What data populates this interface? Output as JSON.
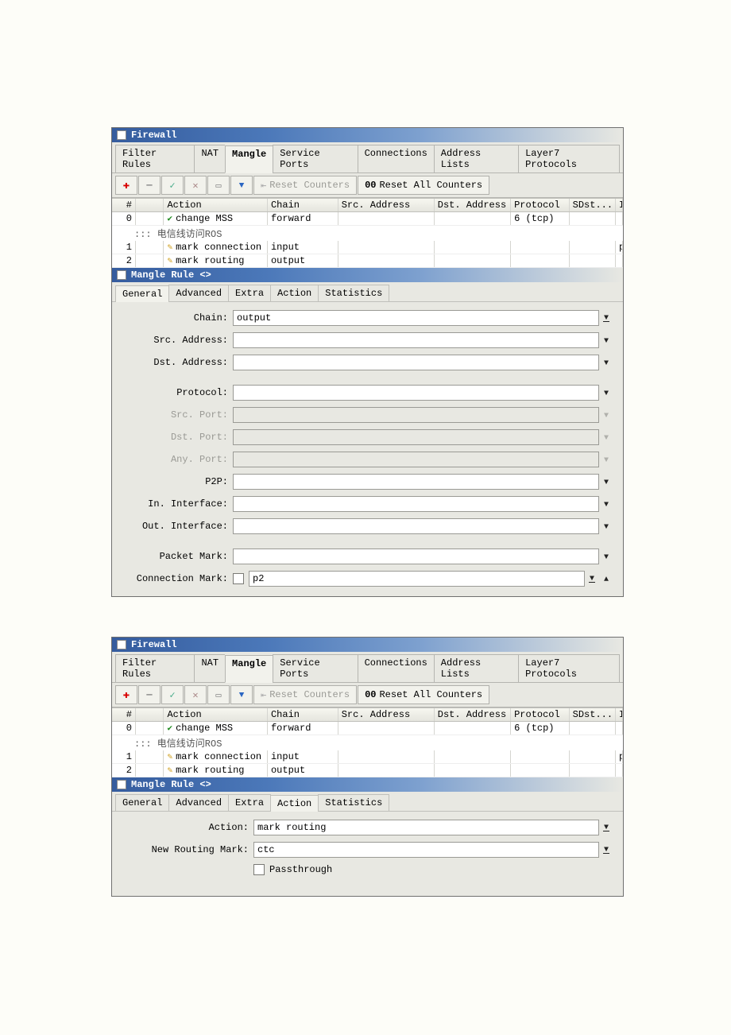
{
  "window1": {
    "title": "Firewall",
    "tabs": [
      "Filter Rules",
      "NAT",
      "Mangle",
      "Service Ports",
      "Connections",
      "Address Lists",
      "Layer7 Protocols"
    ],
    "active_tab": 2,
    "toolbar": {
      "reset_counters": "Reset Counters",
      "reset_all": "Reset All Counters",
      "reset_all_prefix": "00"
    },
    "columns": [
      "#",
      "",
      "Action",
      "Chain",
      "Src. Address",
      "Dst. Address",
      "Protocol",
      "SDst...",
      "In. In"
    ],
    "rows": [
      {
        "idx": "0",
        "action": "change MSS",
        "icon": "check",
        "chain": "forward",
        "src": "",
        "dst": "",
        "proto": "6 (tcp)",
        "sdst": "",
        "in": ""
      }
    ],
    "comment_row": "::: 电信线访问ROS",
    "rows2": [
      {
        "idx": "1",
        "action": "mark connection",
        "icon": "pen",
        "chain": "input",
        "src": "",
        "dst": "",
        "proto": "",
        "sdst": "",
        "in": "pppoe-"
      },
      {
        "idx": "2",
        "action": "mark routing",
        "icon": "pen",
        "chain": "output",
        "src": "",
        "dst": "",
        "proto": "",
        "sdst": "",
        "in": ""
      }
    ]
  },
  "dialog1": {
    "title": "Mangle Rule <>",
    "tabs": [
      "General",
      "Advanced",
      "Extra",
      "Action",
      "Statistics"
    ],
    "active_tab": 0,
    "fields": {
      "chain": {
        "label": "Chain:",
        "value": "output"
      },
      "src_addr": {
        "label": "Src. Address:",
        "value": ""
      },
      "dst_addr": {
        "label": "Dst. Address:",
        "value": ""
      },
      "protocol": {
        "label": "Protocol:",
        "value": ""
      },
      "src_port": {
        "label": "Src. Port:",
        "value": "",
        "disabled": true
      },
      "dst_port": {
        "label": "Dst. Port:",
        "value": "",
        "disabled": true
      },
      "any_port": {
        "label": "Any. Port:",
        "value": "",
        "disabled": true
      },
      "p2p": {
        "label": "P2P:",
        "value": ""
      },
      "in_if": {
        "label": "In. Interface:",
        "value": ""
      },
      "out_if": {
        "label": "Out. Interface:",
        "value": ""
      },
      "packet_mark": {
        "label": "Packet Mark:",
        "value": ""
      },
      "conn_mark": {
        "label": "Connection Mark:",
        "value": "p2"
      }
    }
  },
  "dialog2": {
    "title": "Mangle Rule <>",
    "tabs": [
      "General",
      "Advanced",
      "Extra",
      "Action",
      "Statistics"
    ],
    "active_tab": 3,
    "fields": {
      "action": {
        "label": "Action:",
        "value": "mark routing"
      },
      "new_routing_mark": {
        "label": "New Routing Mark:",
        "value": "ctc"
      },
      "passthrough": {
        "label": "Passthrough"
      }
    }
  }
}
